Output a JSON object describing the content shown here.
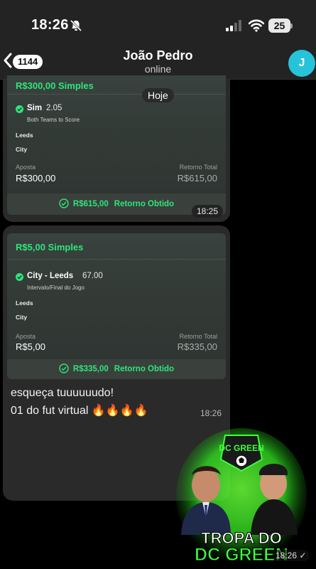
{
  "status_bar": {
    "time": "18:26",
    "battery": "25"
  },
  "header": {
    "back_count": "1144",
    "contact_name": "João Pedro",
    "contact_status": "online",
    "avatar_initial": "J"
  },
  "date_pill": "Hoje",
  "bets": [
    {
      "title": "R$300,00 Simples",
      "selection": "Sim",
      "odds": "2.05",
      "market": "Both Teams to Score",
      "team_home": "Leeds",
      "team_away": "City",
      "stake_label": "Aposta",
      "stake_value": "R$300,00",
      "return_label": "Retorno Total",
      "return_value": "R$615,00",
      "obtained_value": "R$615,00",
      "obtained_label": "Retorno Obtido",
      "time": "18:25"
    },
    {
      "title": "R$5,00 Simples",
      "selection": "City - Leeds",
      "odds": "67.00",
      "market": "Intervalo/Final do Jogo",
      "team_home": "Leeds",
      "team_away": "City",
      "stake_label": "Aposta",
      "stake_value": "R$5,00",
      "return_label": "Retorno Total",
      "return_value": "R$335,00",
      "obtained_value": "R$335,00",
      "obtained_label": "Retorno Obtido"
    }
  ],
  "message": {
    "line1": "esqueça tuuuuuudo!",
    "line2": "01 do fut virtual 🔥🔥🔥🔥",
    "time": "18:26"
  },
  "sticker": {
    "badge_text": "DC GREEN",
    "caption_line1": "TROPA DO",
    "caption_line2": "DC GREEN",
    "time": "18:26 ✓"
  },
  "colors": {
    "accent_green": "#2ee57c",
    "avatar": "#27c3d9"
  }
}
